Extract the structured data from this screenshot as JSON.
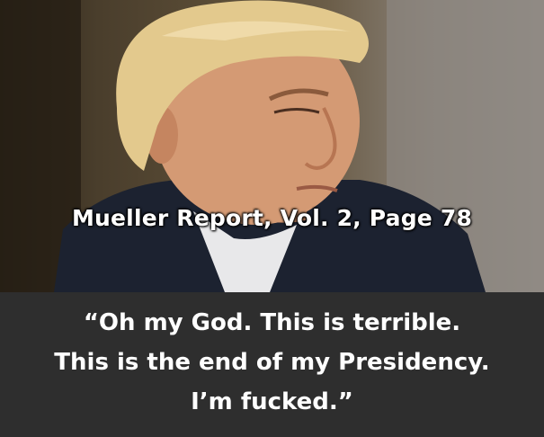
{
  "photo": {
    "subject": "photograph"
  },
  "caption": {
    "source": "Mueller Report, Vol. 2, Page 78"
  },
  "quote": {
    "lines": [
      "“Oh my God. This is terrible.",
      "This is the end of my Presidency.",
      "I’m fucked.”"
    ]
  },
  "colors": {
    "panel": "#2e2e2e",
    "text": "#ffffff"
  }
}
